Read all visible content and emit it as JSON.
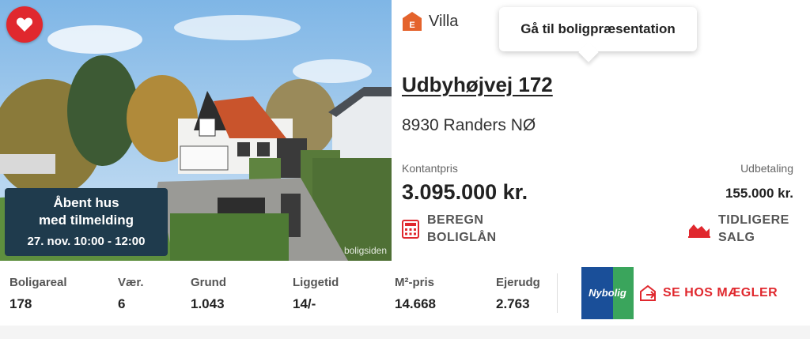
{
  "listing": {
    "type": "Villa",
    "type_badge": "E",
    "tooltip": "Gå til boligpræsentation",
    "address": "Udbyhøjvej 172",
    "city": "8930 Randers NØ",
    "price_label": "Kontantpris",
    "price": "3.095.000 kr.",
    "downpayment_label": "Udbetaling",
    "downpayment": "155.000 kr.",
    "calc_line1": "BEREGN",
    "calc_line2": "BOLIGLÅN",
    "history_line1": "TIDLIGERE",
    "history_line2": "SALG"
  },
  "photo": {
    "open_house_line1": "Åbent hus",
    "open_house_line2": "med tilmelding",
    "open_house_time": "27. nov. 10:00 - 12:00",
    "watermark": "boligsiden"
  },
  "stats": [
    {
      "label": "Boligareal",
      "value": "178"
    },
    {
      "label": "Vær.",
      "value": "6"
    },
    {
      "label": "Grund",
      "value": "1.043"
    },
    {
      "label": "Liggetid",
      "value": "14/-"
    },
    {
      "label": "M²-pris",
      "value": "14.668"
    },
    {
      "label": "Ejerudg",
      "value": "2.763"
    }
  ],
  "broker": {
    "logo_text": "Nybolig",
    "button_label": "SE HOS MÆGLER"
  },
  "colors": {
    "accent": "#e0282e",
    "open_house_bg": "#1f3b4d",
    "type_badge": "#e4632c",
    "logo_blue": "#1a4f99",
    "logo_green": "#3aa55c"
  },
  "icons": [
    "heart-icon",
    "energy-label-icon",
    "calculator-icon",
    "chart-icon",
    "external-link-icon"
  ]
}
